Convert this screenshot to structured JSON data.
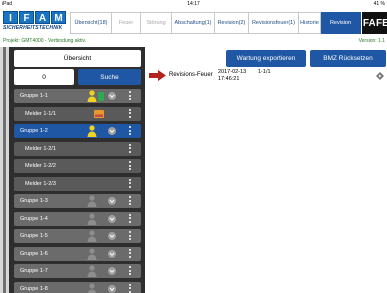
{
  "statusbar": {
    "device": "iPad",
    "time": "14:17",
    "battery": "41 %"
  },
  "logo": {
    "letters": [
      "I",
      "F",
      "A",
      "M"
    ],
    "tagline": "SICHERHEITSTECHNIK"
  },
  "tabs": [
    {
      "label": "Übersicht(18)",
      "state": "normal"
    },
    {
      "label": "Feuer",
      "state": "disabled"
    },
    {
      "label": "Störung",
      "state": "disabled"
    },
    {
      "label": "Abschaltung(1)",
      "state": "normal"
    },
    {
      "label": "Revision(2)",
      "state": "normal"
    },
    {
      "label": "Revisionsfeuer(1)",
      "state": "normal"
    },
    {
      "label": "Historie",
      "state": "normal"
    },
    {
      "label": "Revision",
      "state": "active"
    }
  ],
  "fat_label": "FAT",
  "fe_label": "FE",
  "project": {
    "status": "Projekt: GMT4000 - Verbindung aktiv.",
    "version": "Version: 1.1"
  },
  "sidebar": {
    "header": "Übersicht",
    "search_value": "0",
    "search_button": "Suche",
    "rows": [
      {
        "label": "Gruppe 1-1",
        "kind": "group",
        "icons": [
          "person-yellow",
          "green-box",
          "circle"
        ]
      },
      {
        "label": "Melder 1-1/1",
        "kind": "child",
        "icons": [
          "card"
        ]
      },
      {
        "label": "Gruppe 1-2",
        "kind": "group",
        "selected": true,
        "icons": [
          "person-yellow",
          "circle"
        ]
      },
      {
        "label": "Melder 1-2/1",
        "kind": "child",
        "icons": []
      },
      {
        "label": "Melder 1-2/2",
        "kind": "child",
        "icons": []
      },
      {
        "label": "Melder 1-2/3",
        "kind": "child",
        "icons": []
      },
      {
        "label": "Gruppe 1-3",
        "kind": "group",
        "icons": [
          "person-grey",
          "circle"
        ]
      },
      {
        "label": "Gruppe 1-4",
        "kind": "group",
        "icons": [
          "person-grey",
          "circle"
        ]
      },
      {
        "label": "Gruppe 1-5",
        "kind": "group",
        "icons": [
          "person-grey",
          "circle"
        ]
      },
      {
        "label": "Gruppe 1-6",
        "kind": "group",
        "icons": [
          "person-grey",
          "circle"
        ]
      },
      {
        "label": "Gruppe 1-7",
        "kind": "group",
        "icons": [
          "person-grey",
          "circle"
        ]
      },
      {
        "label": "Gruppe 1-8",
        "kind": "group",
        "icons": [
          "person-grey",
          "circle"
        ]
      }
    ]
  },
  "actions": {
    "export": "Wartung exportieren",
    "reset": "BMZ Rücksetzen"
  },
  "event": {
    "type": "Revisions-Feuer",
    "date": "2017-02-13",
    "time": "17:46:21",
    "code": "1-1/1"
  },
  "colors": {
    "accent": "#1f57a4",
    "arrow": "#b4241f",
    "status_text": "#2a7b2a"
  }
}
